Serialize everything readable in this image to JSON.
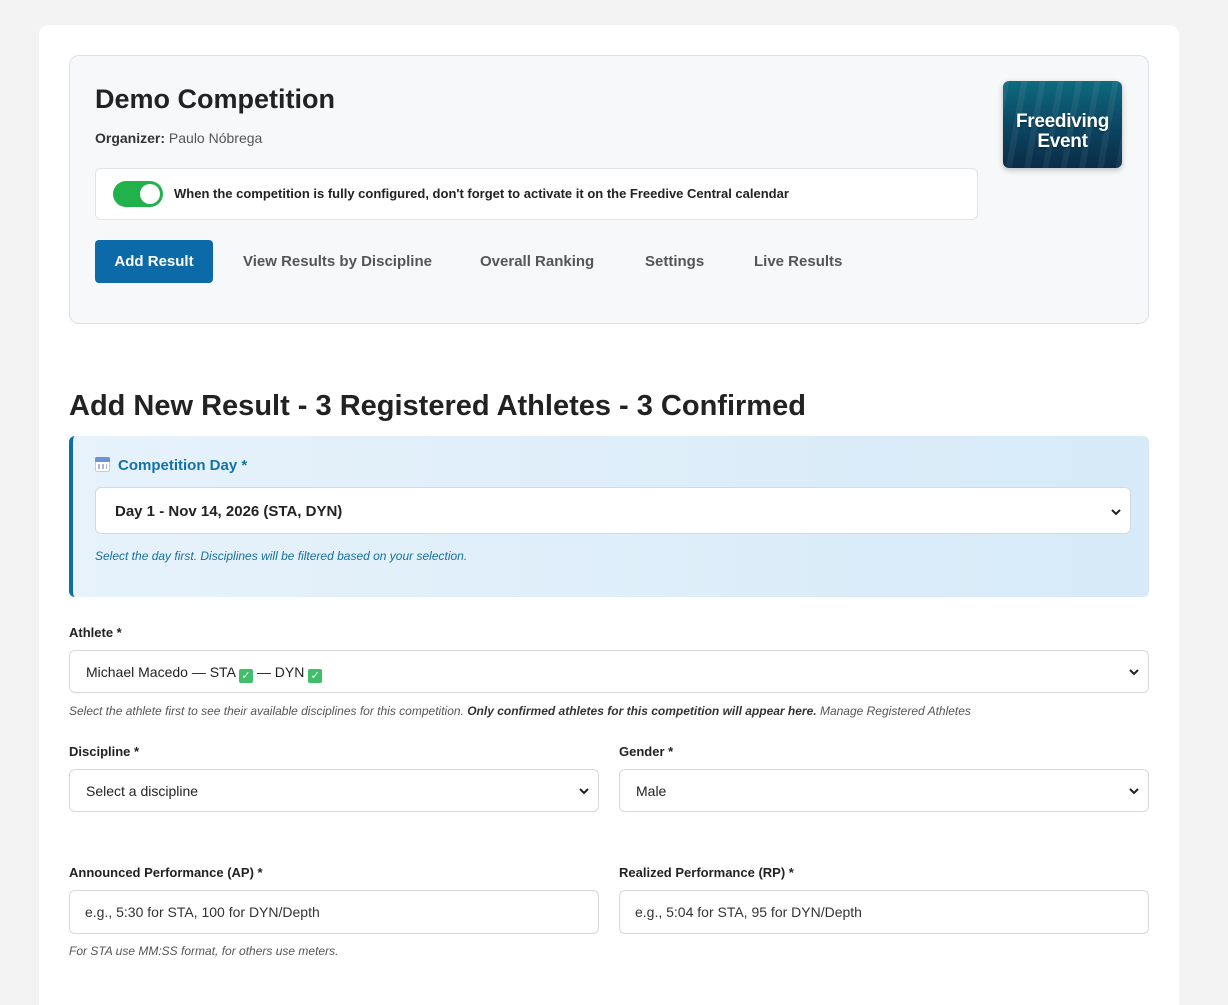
{
  "top_cut_text": "",
  "competition": {
    "title": "Demo Competition",
    "organizer_label": "Organizer:",
    "organizer_name": "Paulo Nóbrega",
    "logo_line1": "Freediving",
    "logo_line2": "Event",
    "notice": "When the competition is fully configured, don't forget to activate it on the Freedive Central calendar",
    "toggle_on": true
  },
  "tabs": [
    {
      "label": "Add Result",
      "active": true
    },
    {
      "label": "View Results by Discipline",
      "active": false
    },
    {
      "label": "Overall Ranking",
      "active": false
    },
    {
      "label": "Settings",
      "active": false
    },
    {
      "label": "Live Results",
      "active": false
    }
  ],
  "form": {
    "title": "Add New Result - 3 Registered Athletes - 3 Confirmed",
    "day": {
      "label": "Competition Day *",
      "selected": "Day 1 - Nov 14, 2026 (STA, DYN)",
      "hint": "Select the day first. Disciplines will be filtered based on your selection."
    },
    "athlete": {
      "label": "Athlete *",
      "name": "Michael Macedo — STA",
      "sep": "— DYN",
      "check": "✓",
      "hint_plain": "Select the athlete first to see their available disciplines for this competition. ",
      "hint_bold": "Only confirmed athletes for this competition will appear here.",
      "hint_link": " Manage Registered Athletes"
    },
    "discipline": {
      "label": "Discipline *",
      "selected": "Select a discipline"
    },
    "gender": {
      "label": "Gender *",
      "selected": "Male"
    },
    "ap": {
      "label": "Announced Performance (AP) *",
      "placeholder": "e.g., 5:30 for STA, 100 for DYN/Depth"
    },
    "rp": {
      "label": "Realized Performance (RP) *",
      "placeholder": "e.g., 5:04 for STA, 95 for DYN/Depth"
    },
    "perf_hint": "For STA use MM:SS format, for others use meters."
  },
  "colors": {
    "primary": "#0c6aa8",
    "toggle": "#22b24c",
    "check": "#3fbf6a"
  }
}
